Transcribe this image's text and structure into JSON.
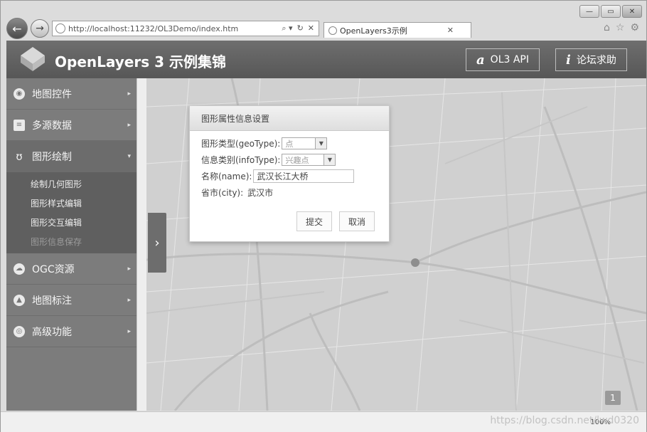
{
  "browser": {
    "url": "http://localhost:11232/OL3Demo/index.htm",
    "tab_title": "OpenLayers3示例",
    "address_actions": [
      "⌕ ▾",
      "↻",
      "✕"
    ],
    "tab_close": "✕",
    "window_buttons": [
      "—",
      "▭",
      "✕"
    ]
  },
  "header": {
    "title": "OpenLayers 3 示例集锦",
    "api_button": {
      "icon": "a",
      "label": "OL3 API"
    },
    "help_button": {
      "icon": "i",
      "label": "论坛求助"
    }
  },
  "sidebar": {
    "items": [
      {
        "label": "地图控件",
        "icon": "map-control-icon",
        "caret": "▸",
        "open": false
      },
      {
        "label": "多源数据",
        "icon": "data-stack-icon",
        "caret": "▸",
        "open": false
      },
      {
        "label": "图形绘制",
        "icon": "drawing-icon",
        "caret": "▾",
        "open": true,
        "subitems": [
          "绘制几何图形",
          "图形样式编辑",
          "图形交互编辑",
          "图形信息保存"
        ]
      },
      {
        "label": "OGC资源",
        "icon": "cloud-icon",
        "caret": "▸",
        "open": false
      },
      {
        "label": "地图标注",
        "icon": "marker-icon",
        "caret": "▸",
        "open": false
      },
      {
        "label": "高级功能",
        "icon": "advanced-icon",
        "caret": "▸",
        "open": false
      }
    ],
    "active_subitem": "图形信息保存"
  },
  "map": {
    "toggle_handle": "›",
    "zoom_badge": "1"
  },
  "dialog": {
    "title": "图形属性信息设置",
    "geo_type_label": "图形类型(geoType):",
    "geo_type_value": "点",
    "info_type_label": "信息类别(infoType):",
    "info_type_value": "兴趣点",
    "name_label": "名称(name):",
    "name_value": "武汉长江大桥",
    "city_label": "省市(city):",
    "city_value": "武汉市",
    "submit_label": "提交",
    "cancel_label": "取消"
  },
  "statusbar": {
    "zoom": "100%",
    "watermark": "https://blog.csdn.net/lwd0320"
  }
}
